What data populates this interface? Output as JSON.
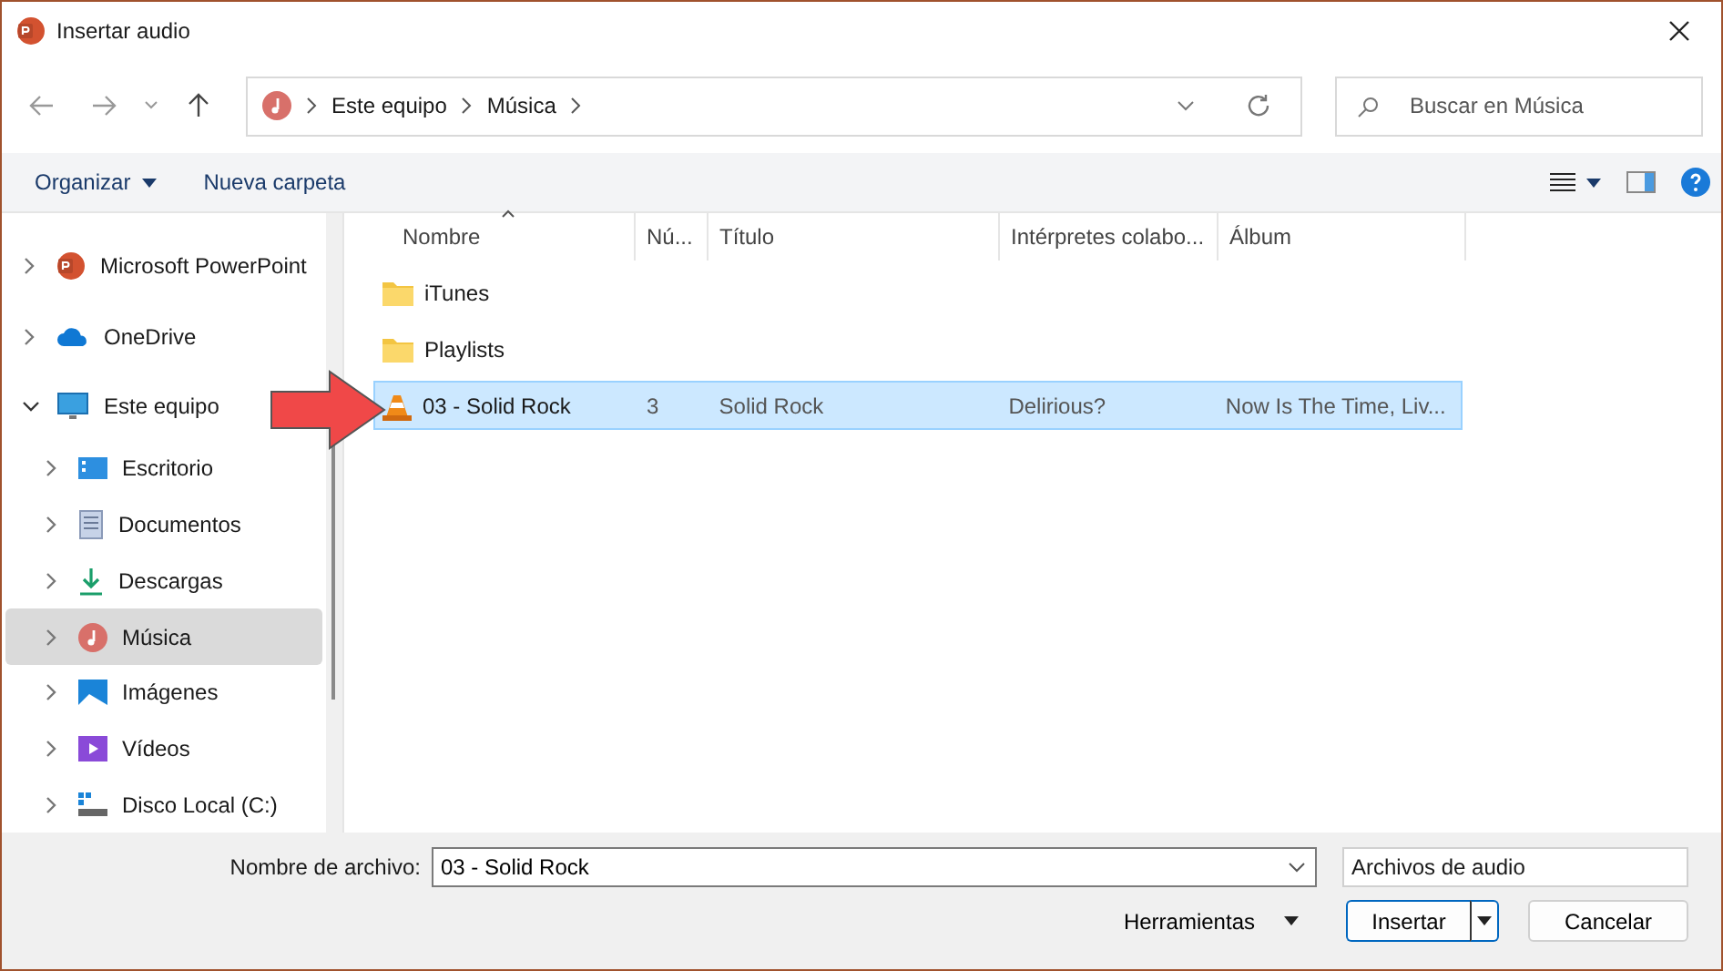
{
  "window": {
    "title": "Insertar audio"
  },
  "address_bar": {
    "path": [
      "Este equipo",
      "Música"
    ]
  },
  "search": {
    "placeholder": "Buscar en Música"
  },
  "toolbar": {
    "organize": "Organizar",
    "new_folder": "Nueva carpeta"
  },
  "sidebar": {
    "items": [
      {
        "label": "Microsoft PowerPoint",
        "kind": "powerpoint",
        "expanded": false,
        "selected": false
      },
      {
        "label": "OneDrive",
        "kind": "cloud",
        "expanded": false,
        "selected": false
      },
      {
        "label": "Este equipo",
        "kind": "pc",
        "expanded": true,
        "selected": false,
        "children": [
          {
            "label": "Escritorio",
            "kind": "desktop",
            "expanded": false,
            "selected": false
          },
          {
            "label": "Documentos",
            "kind": "documents",
            "expanded": false,
            "selected": false
          },
          {
            "label": "Descargas",
            "kind": "downloads",
            "expanded": false,
            "selected": false
          },
          {
            "label": "Música",
            "kind": "music",
            "expanded": false,
            "selected": true
          },
          {
            "label": "Imágenes",
            "kind": "pictures",
            "expanded": false,
            "selected": false
          },
          {
            "label": "Vídeos",
            "kind": "videos",
            "expanded": false,
            "selected": false
          },
          {
            "label": "Disco Local (C:)",
            "kind": "drive",
            "expanded": false,
            "selected": false
          }
        ]
      }
    ]
  },
  "table": {
    "columns": [
      "Nombre",
      "Nú...",
      "Título",
      "Intérpretes colabo...",
      "Álbum"
    ],
    "rows": [
      {
        "kind": "folder",
        "selected": false,
        "cells": [
          "iTunes"
        ]
      },
      {
        "kind": "folder",
        "selected": false,
        "cells": [
          "Playlists"
        ]
      },
      {
        "kind": "audio",
        "selected": true,
        "cells": [
          "03 - Solid Rock",
          "3",
          "Solid Rock",
          "Delirious?",
          "Now Is The Time, Liv..."
        ]
      }
    ]
  },
  "footer": {
    "filename_label": "Nombre de archivo:",
    "filename": "03 - Solid Rock",
    "filetype": "Archivos de audio",
    "tools": "Herramientas",
    "insert": "Insertar",
    "cancel": "Cancelar"
  }
}
